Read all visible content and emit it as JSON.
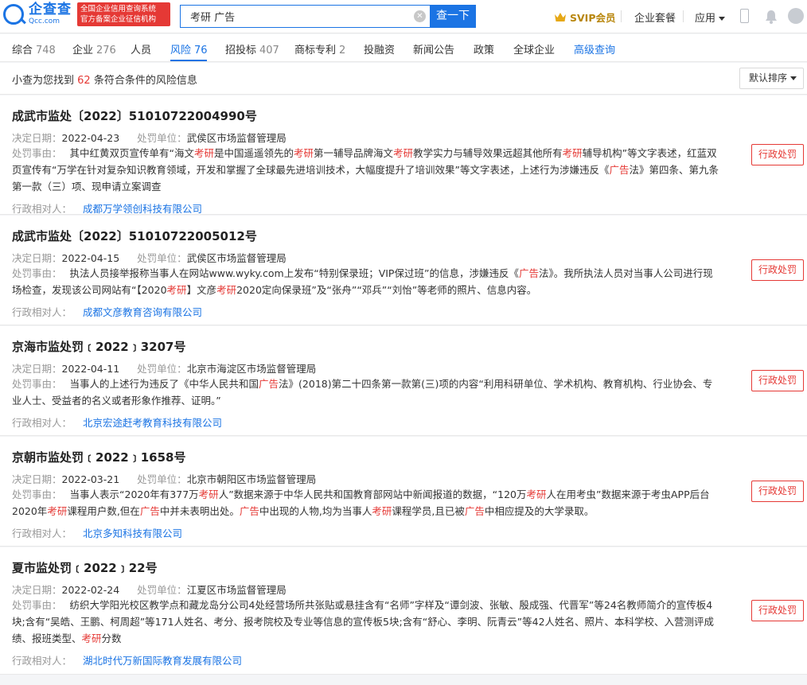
{
  "header": {
    "logo_title": "企查查",
    "logo_domain": "Qcc.com",
    "logo_badge_line1": "全国企业信用查询系统",
    "logo_badge_line2": "官方备案企业征信机构",
    "search_value": "考研 广告",
    "search_button": "查一下",
    "svip_label": "SVIP会员",
    "package_label": "企业套餐",
    "apps_label": "应用"
  },
  "tabs": [
    {
      "label": "综合",
      "count": "748"
    },
    {
      "label": "企业",
      "count": "276"
    },
    {
      "label": "人员",
      "count": ""
    },
    {
      "label": "风险",
      "count": "76"
    },
    {
      "label": "招投标",
      "count": "407"
    },
    {
      "label": "商标专利",
      "count": "2"
    },
    {
      "label": "投融资",
      "count": ""
    },
    {
      "label": "新闻公告",
      "count": ""
    },
    {
      "label": "政策",
      "count": ""
    },
    {
      "label": "全球企业",
      "count": ""
    },
    {
      "label": "高级查询",
      "count": ""
    }
  ],
  "summary": {
    "prefix": "小查为您找到",
    "count": "62",
    "suffix": "条符合条件的风险信息",
    "sort_label": "默认排序"
  },
  "labels": {
    "date": "决定日期：",
    "unit": "处罚单位：",
    "reason": "处罚事由：",
    "party": "行政相对人："
  },
  "records": [
    {
      "title": "成武市监处〔2022〕51010722004990号",
      "date": "2022-04-23",
      "unit": "武侯区市场监督管理局",
      "reason": [
        {
          "t": "其中红黄双页宣传单有“海文"
        },
        {
          "t": "考研",
          "k": true
        },
        {
          "t": "是中国遥遥领先的"
        },
        {
          "t": "考研",
          "k": true
        },
        {
          "t": "第一辅导品牌海文"
        },
        {
          "t": "考研",
          "k": true
        },
        {
          "t": "教学实力与辅导效果远超其他所有"
        },
        {
          "t": "考研",
          "k": true
        },
        {
          "t": "辅导机构”等文字表述，红蓝双页宣传有“万学在针对复杂知识教育领域，开发和掌握了全球最先进培训技术，大幅度提升了培训效果”等文字表述，上述行为涉嫌违反《"
        },
        {
          "t": "广告",
          "k": true
        },
        {
          "t": "法》第四条、第九条第一款（三）项、现申请立案调查"
        }
      ],
      "party": "成都万学领创科技有限公司",
      "tag": "行政处罚"
    },
    {
      "title": "成武市监处〔2022〕51010722005012号",
      "date": "2022-04-15",
      "unit": "武侯区市场监督管理局",
      "reason": [
        {
          "t": "执法人员接举报称当事人在网站www.wyky.com上发布“特别保录班；VIP保过班”的信息，涉嫌违反《"
        },
        {
          "t": "广告",
          "k": true
        },
        {
          "t": "法》。我所执法人员对当事人公司进行现场检查，发现该公司网站有“【2020"
        },
        {
          "t": "考研",
          "k": true
        },
        {
          "t": "】文彦"
        },
        {
          "t": "考研",
          "k": true
        },
        {
          "t": "2020定向保录班”及“张舟”“邓兵”“刘怡”等老师的照片、信息内容。"
        }
      ],
      "party": "成都文彦教育咨询有限公司",
      "tag": "行政处罚"
    },
    {
      "title": "京海市监处罚﹝2022﹞3207号",
      "date": "2022-04-11",
      "unit": "北京市海淀区市场监督管理局",
      "reason": [
        {
          "t": "当事人的上述行为违反了《中华人民共和国"
        },
        {
          "t": "广告",
          "k": true
        },
        {
          "t": "法》(2018)第二十四条第一款第(三)项的内容“利用科研单位、学术机构、教育机构、行业协会、专业人士、受益者的名义或者形象作推荐、证明。”"
        }
      ],
      "party": "北京宏途赶考教育科技有限公司",
      "tag": "行政处罚"
    },
    {
      "title": "京朝市监处罚﹝2022﹞1658号",
      "date": "2022-03-21",
      "unit": "北京市朝阳区市场监督管理局",
      "reason": [
        {
          "t": "当事人表示“2020年有377万"
        },
        {
          "t": "考研",
          "k": true
        },
        {
          "t": "人”数据来源于中华人民共和国教育部网站中新闻报道的数据，“120万"
        },
        {
          "t": "考研",
          "k": true
        },
        {
          "t": "人在用考虫”数据来源于考虫APP后台2020年"
        },
        {
          "t": "考研",
          "k": true
        },
        {
          "t": "课程用户数,但在"
        },
        {
          "t": "广告",
          "k": true
        },
        {
          "t": "中并未表明出处。"
        },
        {
          "t": "广告",
          "k": true
        },
        {
          "t": "中出现的人物,均为当事人"
        },
        {
          "t": "考研",
          "k": true
        },
        {
          "t": "课程学员,且已被"
        },
        {
          "t": "广告",
          "k": true
        },
        {
          "t": "中相应提及的大学录取。"
        }
      ],
      "party": "北京多知科技有限公司",
      "tag": "行政处罚"
    },
    {
      "title": "夏市监处罚﹝2022﹞22号",
      "date": "2022-02-24",
      "unit": "江夏区市场监督管理局",
      "reason": [
        {
          "t": "纺织大学阳光校区教学点和藏龙岛分公司4处经营场所共张贴或悬挂含有“名师”字样及“谭剑波、张敏、殷成强、代晋军”等24名教师简介的宣传板4块;含有“吴皓、王鹏、柯周超”等171人姓名、考分、报考院校及专业等信息的宣传板5块;含有“舒心、李明、阮青云”等42人姓名、照片、本科学校、入营测评成绩、报班类型、"
        },
        {
          "t": "考研",
          "k": true
        },
        {
          "t": "分数"
        }
      ],
      "party": "湖北时代万新国际教育发展有限公司",
      "tag": "行政处罚"
    }
  ]
}
